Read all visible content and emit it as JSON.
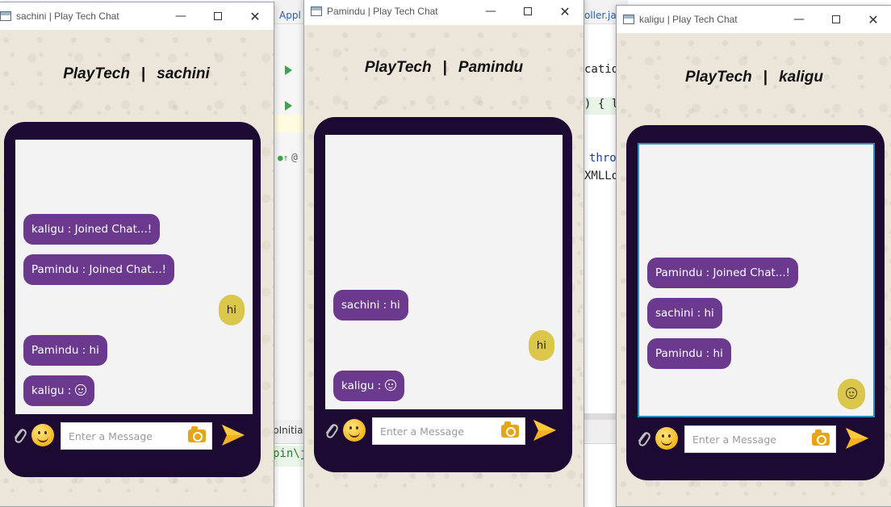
{
  "ide": {
    "tab1": "Appl",
    "tab2": "oller.jav",
    "code_cation": "catio",
    "code_brace": ") { l",
    "code_throw": "thro",
    "code_xml": "XMLLo",
    "bottom_tab": "pInitial",
    "console_line": "pin\\j",
    "gutter_mark": "@"
  },
  "windows": [
    {
      "title": "sachini | Play Tech Chat",
      "brand": "PlayTech",
      "sep": "|",
      "username": "sachini",
      "messages": [
        {
          "text": "kaligu : Joined Chat...!",
          "from": "other"
        },
        {
          "text": "Pamindu : Joined Chat...!",
          "from": "other"
        },
        {
          "text": "hi",
          "from": "self"
        },
        {
          "text": "Pamindu : hi",
          "from": "other"
        },
        {
          "text": "kaligu : ",
          "from": "other",
          "emoji": "smiley"
        }
      ],
      "input_placeholder": "Enter a Message"
    },
    {
      "title": "Pamindu | Play Tech Chat",
      "brand": "PlayTech",
      "sep": "|",
      "username": "Pamindu",
      "messages": [
        {
          "text": "sachini : hi",
          "from": "other"
        },
        {
          "text": "hi",
          "from": "self"
        },
        {
          "text": "kaligu : ",
          "from": "other",
          "emoji": "smiley"
        }
      ],
      "input_placeholder": "Enter a Message"
    },
    {
      "title": "kaligu | Play Tech Chat",
      "brand": "PlayTech",
      "sep": "|",
      "username": "kaligu",
      "messages": [
        {
          "text": "Pamindu : Joined Chat...!",
          "from": "other"
        },
        {
          "text": "sachini : hi",
          "from": "other"
        },
        {
          "text": "Pamindu : hi",
          "from": "other"
        },
        {
          "text": "",
          "from": "self",
          "emoji": "smiley"
        }
      ],
      "input_placeholder": "Enter a Message"
    }
  ],
  "colors": {
    "phone_frame": "#1c0a33",
    "other_bubble": "#6b3a8e",
    "self_bubble": "#d9c64a",
    "send_accent": "#f5b21e"
  }
}
